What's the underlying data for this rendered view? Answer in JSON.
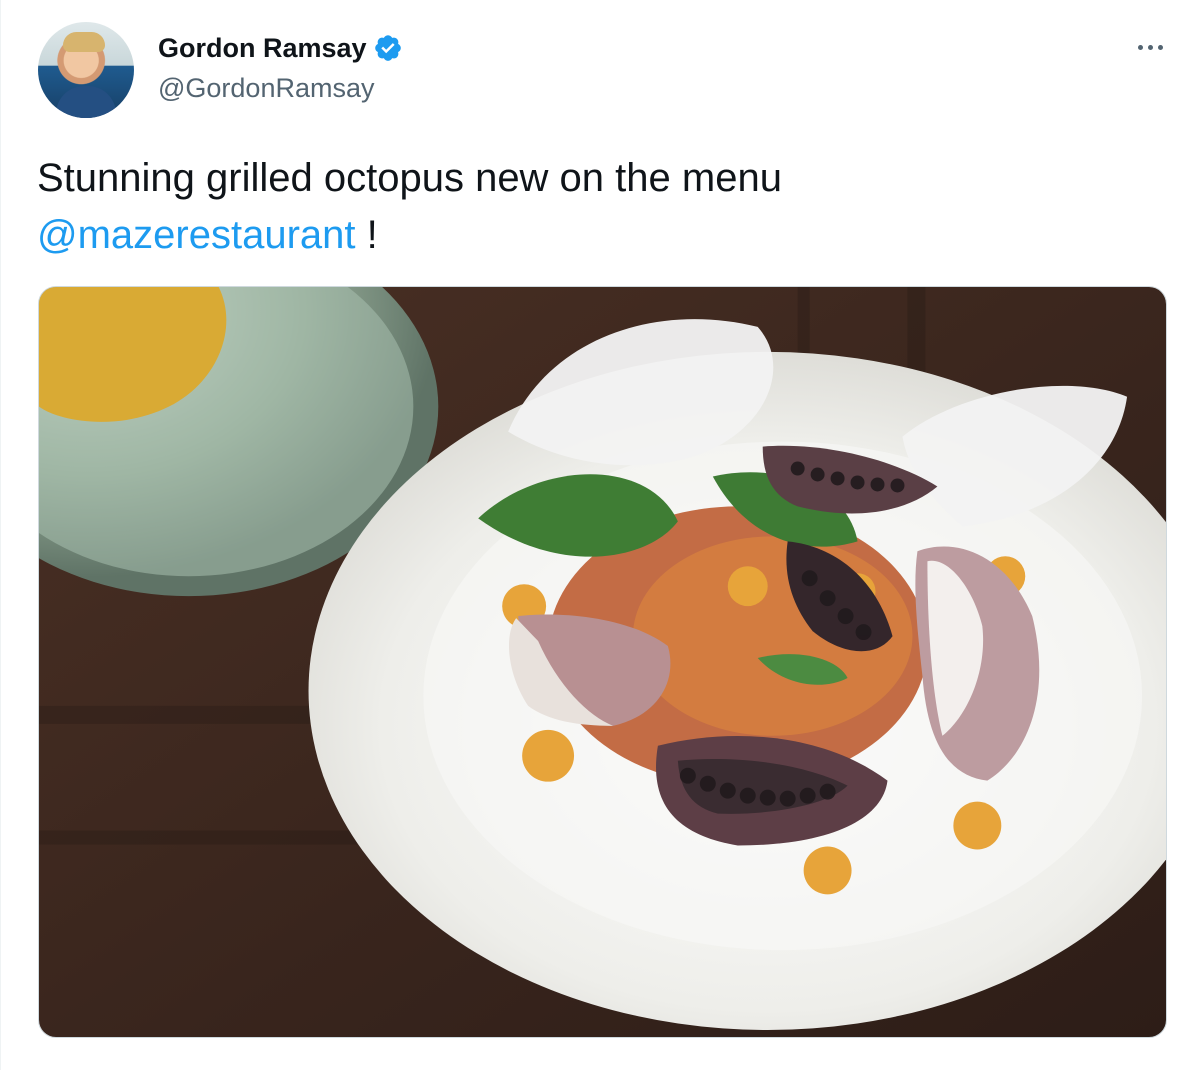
{
  "tweet": {
    "author": {
      "display_name": "Gordon Ramsay",
      "handle": "@GordonRamsay",
      "verified_icon": "verified-badge-icon",
      "avatar_icon": "profile-photo-avatar"
    },
    "text": "Stunning grilled octopus new on the menu",
    "mention": "@mazerestaurant",
    "trailing_text": " !",
    "more_icon": "more-options-icon",
    "media": {
      "icon": "food-photo-image"
    }
  },
  "colors": {
    "text_primary": "#0f1419",
    "text_secondary": "#536471",
    "link": "#1d9bf0",
    "border": "#cfd9de",
    "verified": "#1d9bf0"
  }
}
